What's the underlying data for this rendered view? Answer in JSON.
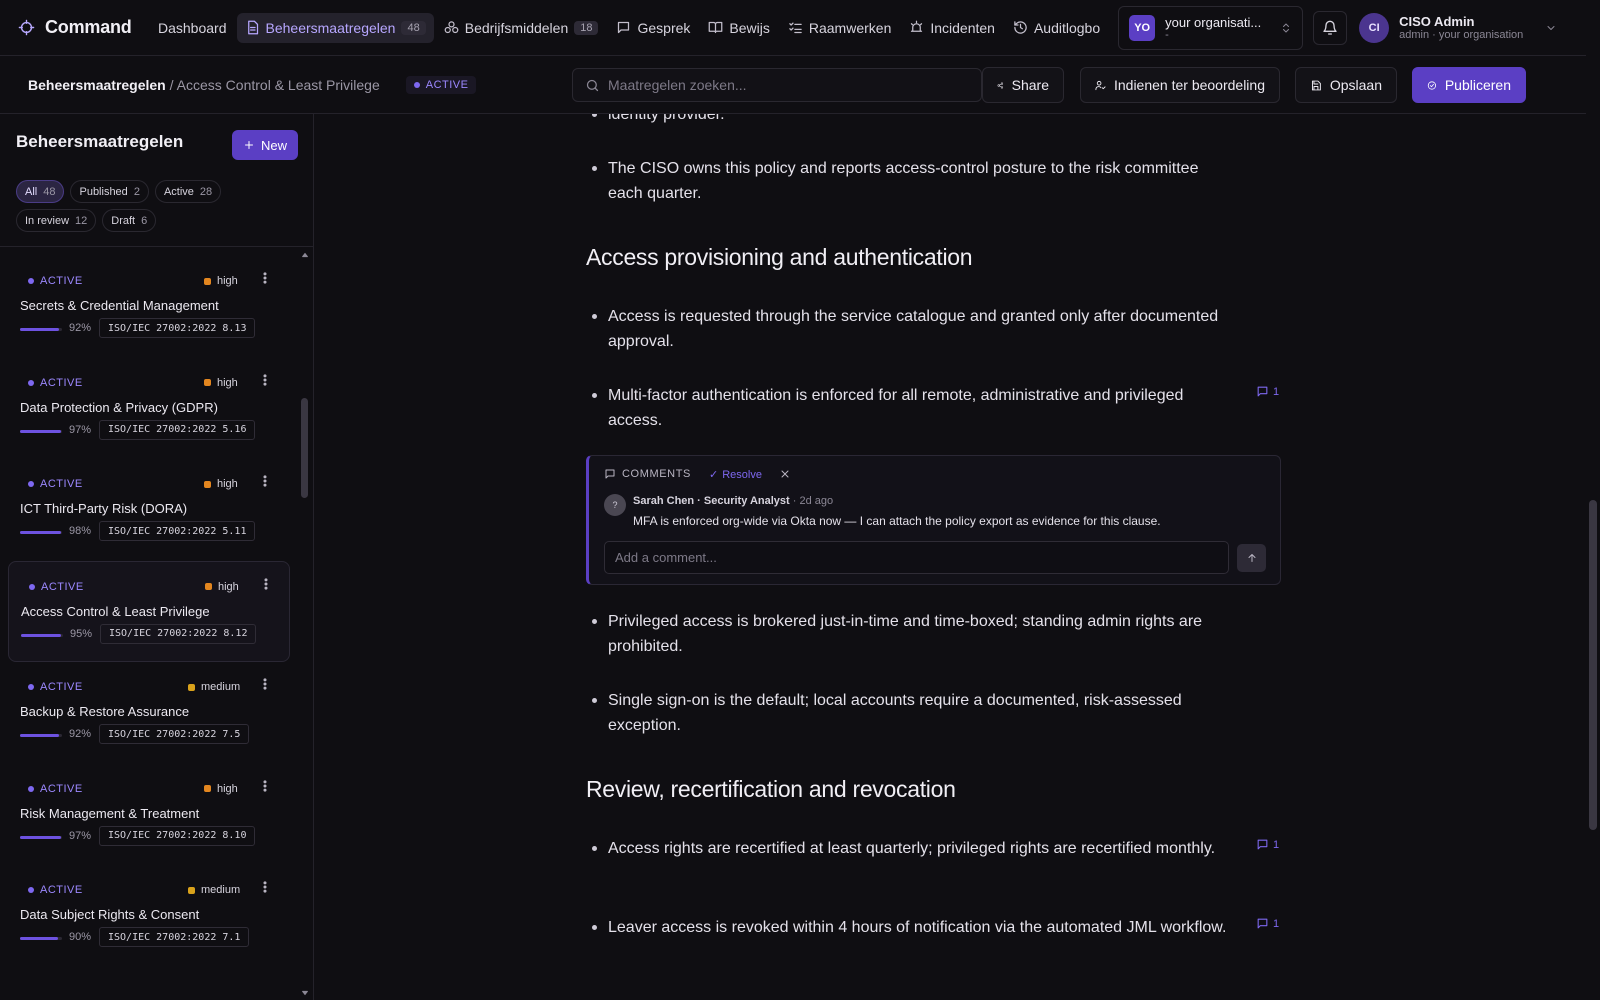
{
  "app": {
    "name": "Command",
    "logo_icon": "command-logo-icon"
  },
  "nav": {
    "items": [
      {
        "label": "Dashboard",
        "icon": "",
        "count": ""
      },
      {
        "label": "Beheersmaatregelen",
        "icon": "document-icon",
        "count": "48"
      },
      {
        "label": "Bedrijfsmiddelen",
        "icon": "assets-icon",
        "count": "18"
      },
      {
        "label": "Gesprek",
        "icon": "chat-icon",
        "count": ""
      },
      {
        "label": "Bewijs",
        "icon": "book-icon",
        "count": ""
      },
      {
        "label": "Raamwerken",
        "icon": "checklist-icon",
        "count": ""
      },
      {
        "label": "Incidenten",
        "icon": "alarm-icon",
        "count": ""
      },
      {
        "label": "Auditlogbo",
        "icon": "history-icon",
        "count": ""
      }
    ],
    "org": {
      "badge": "YO",
      "name": "your organisati...",
      "sub": "-"
    },
    "user": {
      "initials": "CI",
      "name": "CISO Admin",
      "role": "admin · your organisation"
    }
  },
  "subbar": {
    "crumb_root": "Beheersmaatregelen",
    "crumb_sep": " / ",
    "crumb_current": "Access Control & Least Privilege",
    "status": "ACTIVE",
    "search_placeholder": "Maatregelen zoeken...",
    "share_label": "Share",
    "review_label": "Indienen ter beoordeling",
    "save_label": "Opslaan",
    "publish_label": "Publiceren"
  },
  "sidebar": {
    "title": "Beheersmaatregelen",
    "new_label": "New",
    "filters": [
      {
        "label": "All",
        "count": "48"
      },
      {
        "label": "Published",
        "count": "2"
      },
      {
        "label": "Active",
        "count": "28"
      },
      {
        "label": "In review",
        "count": "12"
      },
      {
        "label": "Draft",
        "count": "6"
      }
    ],
    "controls": [
      {
        "status": "ACTIVE",
        "priority": "high",
        "title": "Secrets & Credential Management",
        "progress": 92,
        "progress_label": "92%",
        "ref": "ISO/IEC 27002:2022 8.13"
      },
      {
        "status": "ACTIVE",
        "priority": "high",
        "title": "Data Protection & Privacy (GDPR)",
        "progress": 97,
        "progress_label": "97%",
        "ref": "ISO/IEC 27002:2022 5.16"
      },
      {
        "status": "ACTIVE",
        "priority": "high",
        "title": "ICT Third-Party Risk (DORA)",
        "progress": 98,
        "progress_label": "98%",
        "ref": "ISO/IEC 27002:2022 5.11"
      },
      {
        "status": "ACTIVE",
        "priority": "high",
        "title": "Access Control & Least Privilege",
        "progress": 95,
        "progress_label": "95%",
        "ref": "ISO/IEC 27002:2022 8.12"
      },
      {
        "status": "ACTIVE",
        "priority": "medium",
        "title": "Backup & Restore Assurance",
        "progress": 92,
        "progress_label": "92%",
        "ref": "ISO/IEC 27002:2022 7.5"
      },
      {
        "status": "ACTIVE",
        "priority": "high",
        "title": "Risk Management & Treatment",
        "progress": 97,
        "progress_label": "97%",
        "ref": "ISO/IEC 27002:2022 8.10"
      },
      {
        "status": "ACTIVE",
        "priority": "medium",
        "title": "Data Subject Rights & Consent",
        "progress": 90,
        "progress_label": "90%",
        "ref": "ISO/IEC 27002:2022 7.1"
      }
    ]
  },
  "doc": {
    "fragment": "identity provider.",
    "b_owner": "The CISO owns this policy and reports access-control posture to the risk committee each quarter.",
    "h_provisioning": "Access provisioning and authentication",
    "b_request": "Access is requested through the service catalogue and granted only after documented approval.",
    "b_mfa": "Multi-factor authentication is enforced for all remote, administrative and privileged access.",
    "b_mfa_comments": "1",
    "comments": {
      "heading": "COMMENTS",
      "resolve_label": "Resolve",
      "author_avatar": "?",
      "author": "Sarah Chen · Security Analyst",
      "time": "2d ago",
      "text": "MFA is enforced org-wide via Okta now — I can attach the policy export as evidence for this clause.",
      "input_placeholder": "Add a comment..."
    },
    "b_privileged": "Privileged access is brokered just-in-time and time-boxed; standing admin rights are prohibited.",
    "b_sso": "Single sign-on is the default; local accounts require a documented, risk-assessed exception.",
    "h_review": "Review, recertification and revocation",
    "b_recert": "Access rights are recertified at least quarterly; privileged rights are recertified monthly.",
    "b_recert_comments": "1",
    "b_leaver": "Leaver access is revoked within 4 hours of notification via the automated JML workflow.",
    "b_leaver_comments": "1"
  },
  "colors": {
    "accent": "#5b3fc4",
    "status_active": "#9c88ff",
    "priority_high": "#e3861f",
    "priority_medium": "#d9a21b",
    "background": "#0f0e12"
  }
}
